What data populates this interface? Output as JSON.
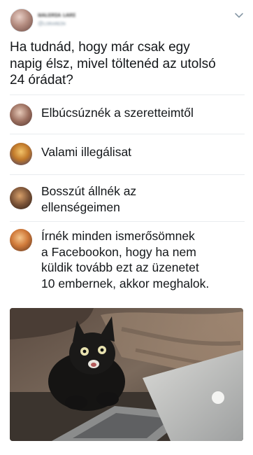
{
  "tweet": {
    "author_name": "ᴚᴀʟᴇʀɪᴀ ʟᴀʀɪ",
    "author_handle": "@ʟᴏʀᴀʀᴇɪɴ",
    "question": "Ha tudnád, hogy már csak egy\nnapig élsz, mivel töltenéd az utolsó\n24 órádat?",
    "options": [
      {
        "text": "Elbúcsúznék a szeretteimtől",
        "avatar_color": "#8a6a60"
      },
      {
        "text": "Valami illegálisat",
        "avatar_color": "#c9782a"
      },
      {
        "text": "Bosszút állnék az\nellenségeimen",
        "avatar_color": "#7a5236"
      },
      {
        "text": "Írnék minden ismerősömnek\na Facebookon, hogy ha nem\nküldik tovább ezt az üzenetet\n10 embernek, akkor meghalok.",
        "avatar_color": "#d07a3a"
      }
    ],
    "image_description_icon": "black-cat-laptop-photo"
  },
  "colors": {
    "text": "#14171a",
    "muted": "#8899a6",
    "separator": "#e9ecef"
  },
  "icons": {
    "caret": "chevron-down-icon"
  }
}
